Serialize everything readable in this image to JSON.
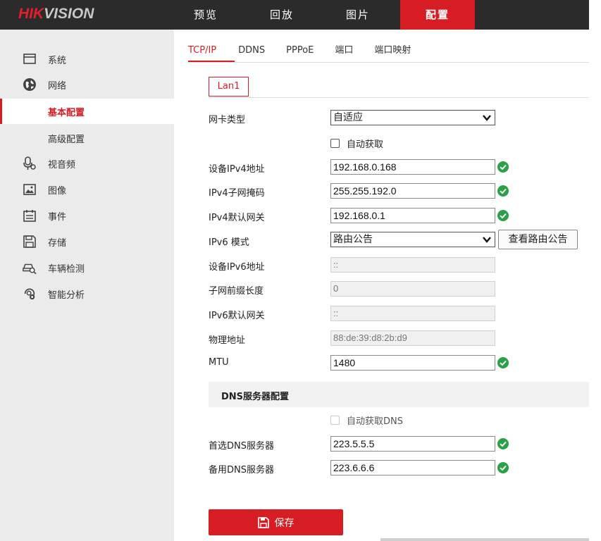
{
  "brand": {
    "hik": "HIK",
    "vision": "VISION"
  },
  "topnav": [
    {
      "label": "预览"
    },
    {
      "label": "回放"
    },
    {
      "label": "图片"
    },
    {
      "label": "配置"
    }
  ],
  "sidebar": {
    "items": [
      {
        "label": "系统",
        "icon": "monitor-icon"
      },
      {
        "label": "网络",
        "icon": "globe-icon"
      },
      {
        "label": "基本配置",
        "icon": ""
      },
      {
        "label": "高级配置",
        "icon": ""
      },
      {
        "label": "视音频",
        "icon": "microphone-icon"
      },
      {
        "label": "图像",
        "icon": "image-icon"
      },
      {
        "label": "事件",
        "icon": "calendar-icon"
      },
      {
        "label": "存储",
        "icon": "floppy-icon"
      },
      {
        "label": "车辆检测",
        "icon": "car-search-icon"
      },
      {
        "label": "智能分析",
        "icon": "smart-analysis-icon"
      }
    ]
  },
  "tabs": [
    {
      "label": "TCP/IP"
    },
    {
      "label": "DDNS"
    },
    {
      "label": "PPPoE"
    },
    {
      "label": "端口"
    },
    {
      "label": "端口映射"
    }
  ],
  "lan_tab": "Lan1",
  "form": {
    "nic_type": {
      "label": "网卡类型",
      "value": "自适应"
    },
    "dhcp": {
      "label": "自动获取",
      "checked": false
    },
    "ipv4_addr": {
      "label": "设备IPv4地址",
      "value": "192.168.0.168"
    },
    "ipv4_mask": {
      "label": "IPv4子网掩码",
      "value": "255.255.192.0"
    },
    "ipv4_gateway": {
      "label": "IPv4默认网关",
      "value": "192.168.0.1"
    },
    "ipv6_mode": {
      "label": "IPv6 模式",
      "value": "路由公告",
      "button": "查看路由公告"
    },
    "ipv6_addr": {
      "label": "设备IPv6地址",
      "value": "::"
    },
    "prefix_len": {
      "label": "子网前缀长度",
      "value": "0"
    },
    "ipv6_gateway": {
      "label": "IPv6默认网关",
      "value": "::"
    },
    "mac": {
      "label": "物理地址",
      "value": "88:de:39:d8:2b:d9"
    },
    "mtu": {
      "label": "MTU",
      "value": "1480"
    }
  },
  "dns": {
    "section_title": "DNS服务器配置",
    "auto_dns": {
      "label": "自动获取DNS",
      "checked": false
    },
    "primary": {
      "label": "首选DNS服务器",
      "value": "223.5.5.5"
    },
    "secondary": {
      "label": "备用DNS服务器",
      "value": "223.6.6.6"
    }
  },
  "save_label": "保存",
  "colors": {
    "accent": "#d71d24",
    "topbar": "#2b2b2b",
    "sidebar": "#ebebeb",
    "ok": "#2aa147"
  }
}
